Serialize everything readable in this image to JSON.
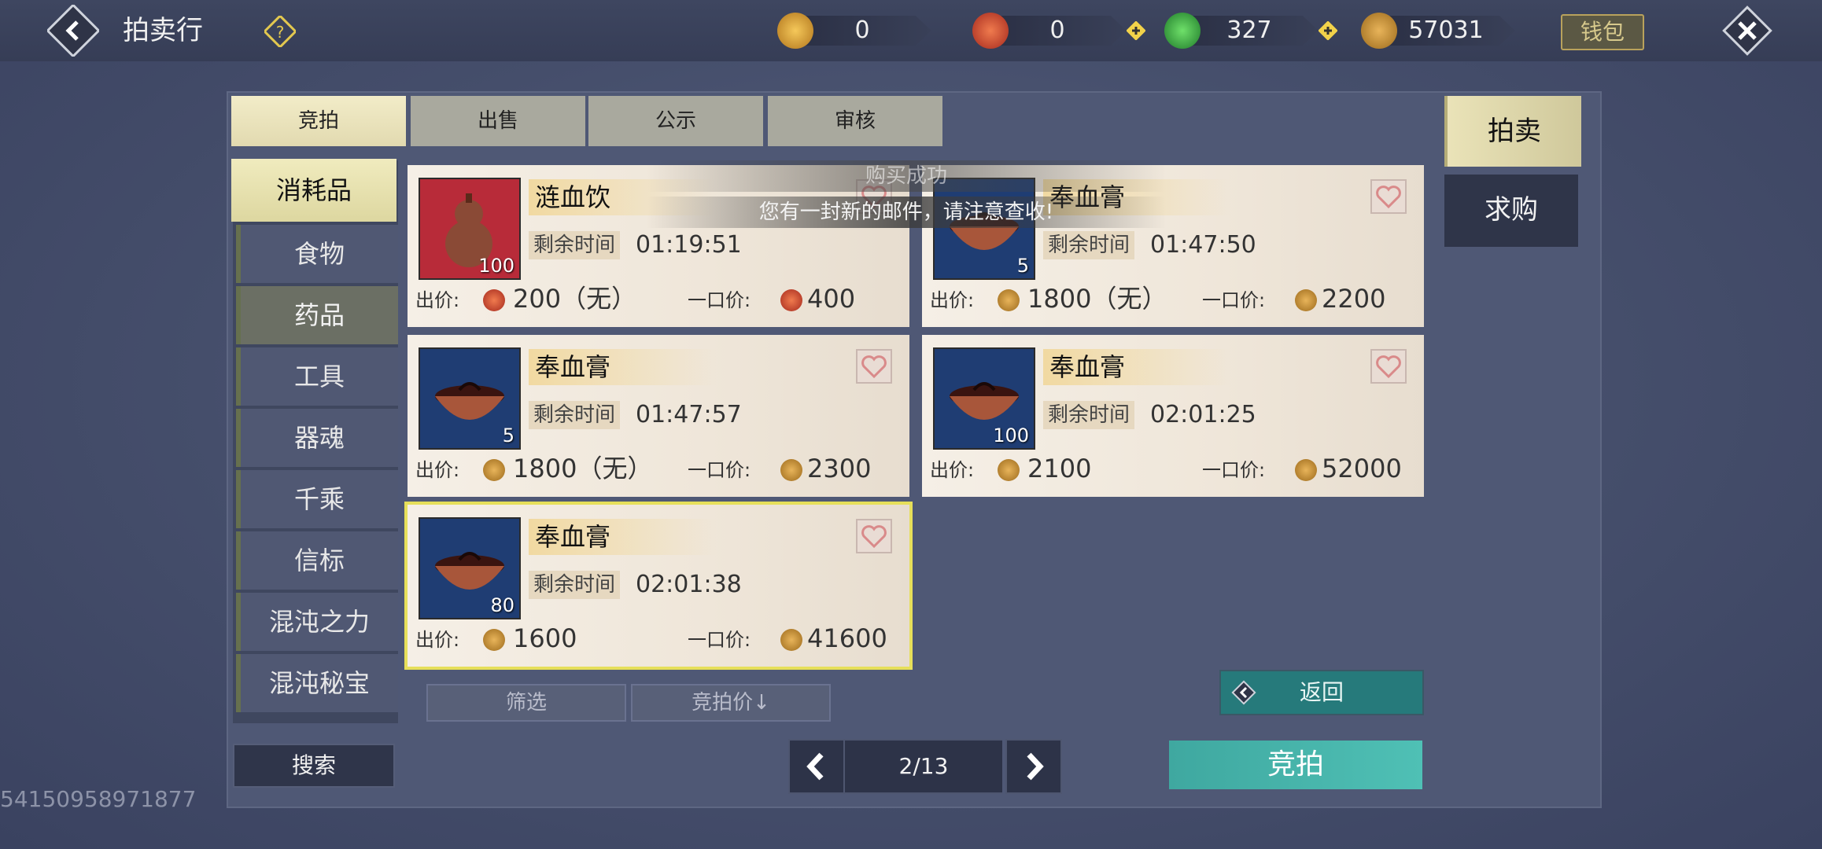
{
  "header": {
    "title": "拍卖行",
    "wallet_label": "钱包",
    "resources": [
      {
        "icon": "gold-pouch-icon",
        "value": "0",
        "has_plus": false
      },
      {
        "icon": "red-spiral-coin-icon",
        "value": "0",
        "has_plus": true
      },
      {
        "icon": "green-jade-icon",
        "value": "327",
        "has_plus": true
      },
      {
        "icon": "leaf-coin-icon",
        "value": "57031",
        "has_plus": false
      }
    ]
  },
  "tabs": [
    "竞拍",
    "出售",
    "公示",
    "审核"
  ],
  "categories": [
    "消耗品",
    "食物",
    "药品",
    "工具",
    "器魂",
    "千乘",
    "信标",
    "混沌之力",
    "混沌秘宝"
  ],
  "listings": [
    {
      "name": "涟血饮",
      "time_label": "剩余时间",
      "time": "01:19:51",
      "qty": "100",
      "bid_label": "出价:",
      "bid": "200（无）",
      "buyout_label": "一口价:",
      "buyout": "400",
      "currency": "red",
      "item": "gourd"
    },
    {
      "name": "奉血膏",
      "time_label": "剩余时间",
      "time": "01:47:50",
      "qty": "5",
      "bid_label": "出价:",
      "bid": "1800（无）",
      "buyout_label": "一口价:",
      "buyout": "2200",
      "currency": "leaf",
      "item": "bowl"
    },
    {
      "name": "奉血膏",
      "time_label": "剩余时间",
      "time": "01:47:57",
      "qty": "5",
      "bid_label": "出价:",
      "bid": "1800（无）",
      "buyout_label": "一口价:",
      "buyout": "2300",
      "currency": "leaf",
      "item": "bowl"
    },
    {
      "name": "奉血膏",
      "time_label": "剩余时间",
      "time": "02:01:25",
      "qty": "100",
      "bid_label": "出价:",
      "bid": "2100",
      "buyout_label": "一口价:",
      "buyout": "52000",
      "currency": "leaf",
      "item": "bowl"
    },
    {
      "name": "奉血膏",
      "time_label": "剩余时间",
      "time": "02:01:38",
      "qty": "80",
      "bid_label": "出价:",
      "bid": "1600",
      "buyout_label": "一口价:",
      "buyout": "41600",
      "currency": "leaf",
      "item": "bowl"
    }
  ],
  "filters": {
    "filter_label": "筛选",
    "sort_label": "竞拍价↓"
  },
  "search_label": "搜索",
  "pagination": {
    "page": "2/13"
  },
  "return_label": "返回",
  "bid_button_label": "竞拍",
  "side_tabs": [
    "拍卖",
    "求购"
  ],
  "toasts": {
    "purchase": "购买成功",
    "mail": "您有一封新的邮件，请注意查收!"
  },
  "user_id": "54150958971877",
  "colors": {
    "accent_teal": "#4fc0b5",
    "tab_active": "#f2ecc8",
    "highlight_border": "#e6df5a"
  }
}
